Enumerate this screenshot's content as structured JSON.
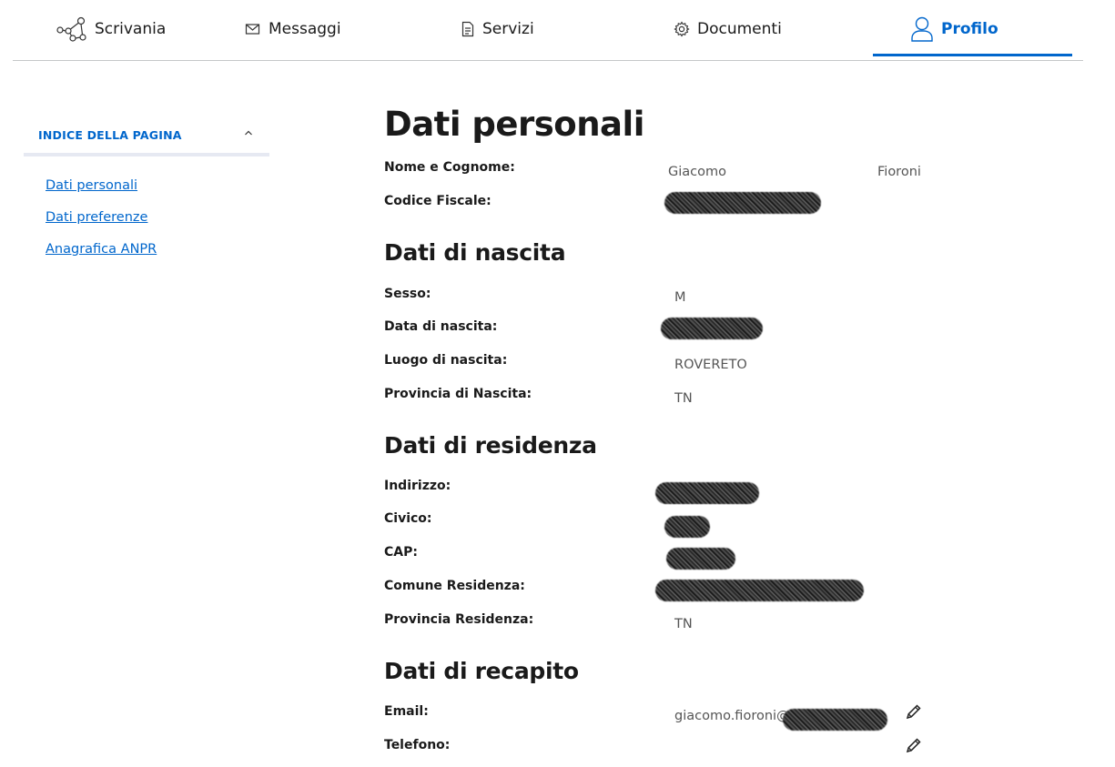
{
  "nav": {
    "items": [
      {
        "label": "Scrivania",
        "icon": "network-icon"
      },
      {
        "label": "Messaggi",
        "icon": "envelope-icon"
      },
      {
        "label": "Servizi",
        "icon": "document-icon"
      },
      {
        "label": "Documenti",
        "icon": "gear-icon"
      },
      {
        "label": "Profilo",
        "icon": "user-icon",
        "active": true
      }
    ],
    "accent_color": "#0066cc"
  },
  "toc": {
    "title": "INDICE DELLA PAGINA",
    "links": [
      "Dati personali",
      "Dati preferenze",
      "Anagrafica ANPR"
    ]
  },
  "main": {
    "title": "Dati personali",
    "personali": {
      "nome_label": "Nome e Cognome:",
      "nome": "Giacomo",
      "cognome": "Fioroni",
      "cf_label": "Codice Fiscale:"
    },
    "nascita": {
      "heading": "Dati di nascita",
      "sesso_label": "Sesso:",
      "sesso": "M",
      "data_label": "Data di nascita:",
      "luogo_label": "Luogo di nascita:",
      "luogo": "ROVERETO",
      "provincia_label": "Provincia di Nascita:",
      "provincia": "TN"
    },
    "residenza": {
      "heading": "Dati di residenza",
      "indirizzo_label": "Indirizzo:",
      "civico_label": "Civico:",
      "cap_label": "CAP:",
      "comune_label": "Comune Residenza:",
      "provincia_label": "Provincia Residenza:",
      "provincia": "TN"
    },
    "recapito": {
      "heading": "Dati di recapito",
      "email_label": "Email:",
      "email_prefix": "giacomo.fioroni@",
      "telefono_label": "Telefono:"
    }
  }
}
